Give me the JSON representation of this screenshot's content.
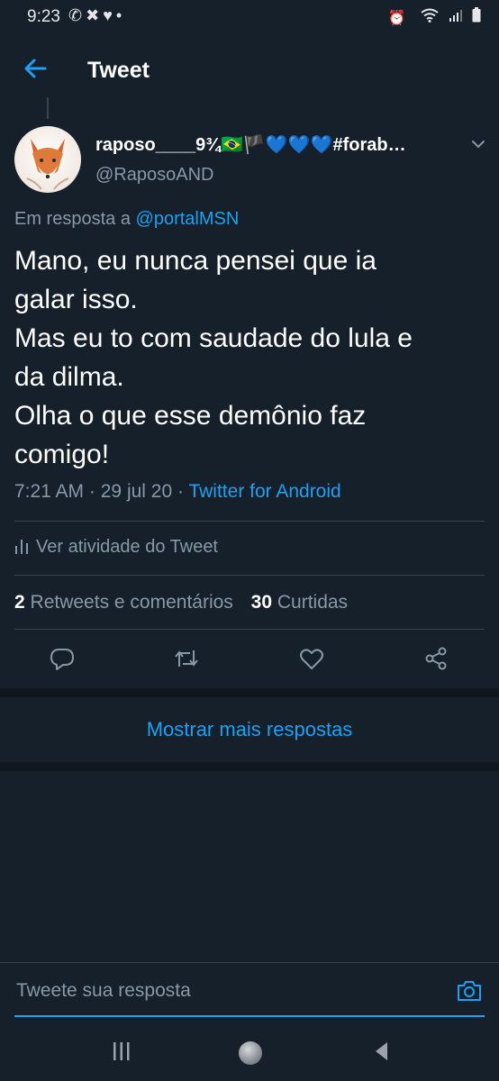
{
  "status_bar": {
    "time": "9:23",
    "left_icons": [
      "whatsapp-icon",
      "app-icon",
      "heart-icon",
      "dot-icon"
    ],
    "right_icons": [
      "alarm-icon",
      "wifi-icon",
      "signal-icon",
      "battery-icon"
    ]
  },
  "header": {
    "title": "Tweet"
  },
  "tweet": {
    "author_name": "raposo____9¾🇧🇷🏴💙💙💙#forab…",
    "author_handle": "@RaposoAND",
    "reply_prefix": "Em resposta a",
    "reply_mention": "@portalMSN",
    "text_lines": [
      "Mano, eu nunca pensei que ia",
      "galar isso.",
      "Mas eu to com saudade do lula e",
      "da dilma.",
      "Olha o que esse demônio faz",
      "comigo!"
    ],
    "time": "7:21 AM",
    "date": "29 jul 20",
    "source": "Twitter for Android"
  },
  "activity_label": "Ver atividade do Tweet",
  "stats": {
    "retweets_count": "2",
    "retweets_label": "Retweets e comentários",
    "likes_count": "30",
    "likes_label": "Curtidas"
  },
  "show_more_label": "Mostrar mais respostas",
  "composer": {
    "placeholder": "Tweete sua resposta"
  },
  "colors": {
    "background": "#15202b",
    "accent": "#1da1f2",
    "secondary_text": "#8899a6",
    "divider": "#38444d"
  }
}
